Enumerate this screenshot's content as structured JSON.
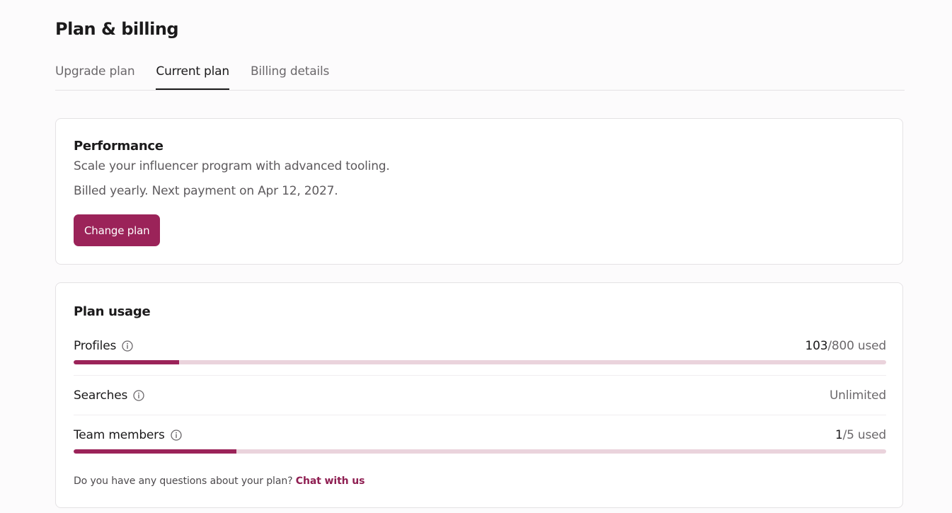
{
  "page": {
    "title": "Plan & billing"
  },
  "tabs": [
    {
      "label": "Upgrade plan",
      "active": false
    },
    {
      "label": "Current plan",
      "active": true
    },
    {
      "label": "Billing details",
      "active": false
    }
  ],
  "plan": {
    "name": "Performance",
    "description": "Scale your influencer program with advanced tooling.",
    "billing": "Billed yearly. Next payment on Apr 12, 2027.",
    "change_button": "Change plan"
  },
  "usage": {
    "title": "Plan usage",
    "rows": [
      {
        "label": "Profiles",
        "used": "103",
        "rest": "/800 used",
        "fraction": 0.13,
        "icon": "info-icon"
      },
      {
        "label": "Searches",
        "value": "Unlimited",
        "icon": "info-icon"
      },
      {
        "label": "Team members",
        "used": "1",
        "rest": "/5 used",
        "fraction": 0.2,
        "icon": "info-icon"
      }
    ],
    "footer_text": "Do you have any questions about your plan? ",
    "footer_link": "Chat with us"
  },
  "colors": {
    "accent": "#9b2359",
    "track": "#ead3dc",
    "link": "#8f1f52"
  }
}
